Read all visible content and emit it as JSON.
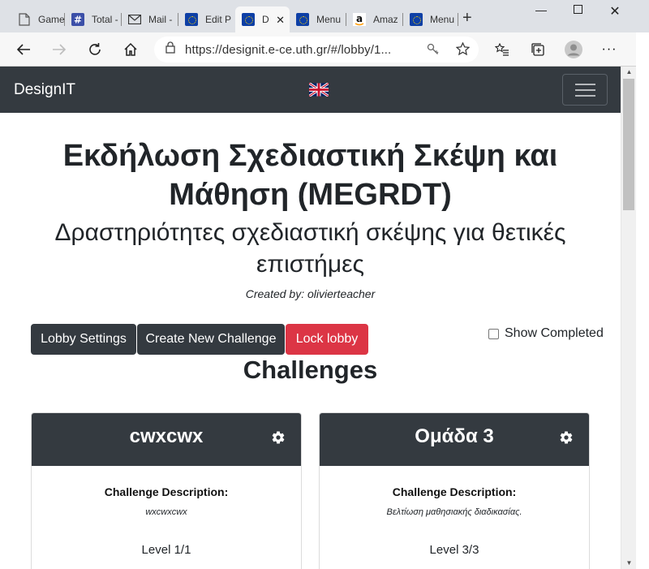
{
  "browser": {
    "tabs": [
      {
        "label": "Game",
        "icon": "page-icon"
      },
      {
        "label": "Total -",
        "icon": "hash-icon"
      },
      {
        "label": "Mail -",
        "icon": "mail-icon"
      },
      {
        "label": "Edit P",
        "icon": "eu-flag-icon"
      },
      {
        "label": "D",
        "icon": "eu-flag-icon",
        "active": true
      },
      {
        "label": "Menu",
        "icon": "eu-flag-icon"
      },
      {
        "label": "Amaz",
        "icon": "amazon-icon"
      },
      {
        "label": "Menu",
        "icon": "eu-flag-icon"
      }
    ],
    "url": "https://designit.e-ce.uth.gr/#/lobby/1..."
  },
  "navbar": {
    "brand": "DesignIT",
    "language_flag": "uk-flag-icon"
  },
  "page": {
    "title": "Εκδήλωση Σχεδιαστική Σκέψη και Μάθηση (MEGRDT)",
    "subtitle": "Δραστηριότητες σχεδιαστική σκέψης για θετικές επιστήμες",
    "created_by": "Created by: olivierteacher",
    "buttons": {
      "lobby_settings": "Lobby Settings",
      "create_challenge": "Create New Challenge",
      "lock_lobby": "Lock lobby"
    },
    "show_completed": "Show Completed",
    "section_title": "Challenges"
  },
  "challenges": [
    {
      "name": "cwxcwx",
      "description_label": "Challenge Description:",
      "description": "wxcwxcwx",
      "level": "Level 1/1"
    },
    {
      "name": "Ομάδα 3",
      "description_label": "Challenge Description:",
      "description": "Βελτίωση μαθησιακής διαδικασίας.",
      "level": "Level 3/3"
    }
  ],
  "colors": {
    "navbar": "#343a40",
    "danger": "#dc3545",
    "text": "#212529"
  }
}
